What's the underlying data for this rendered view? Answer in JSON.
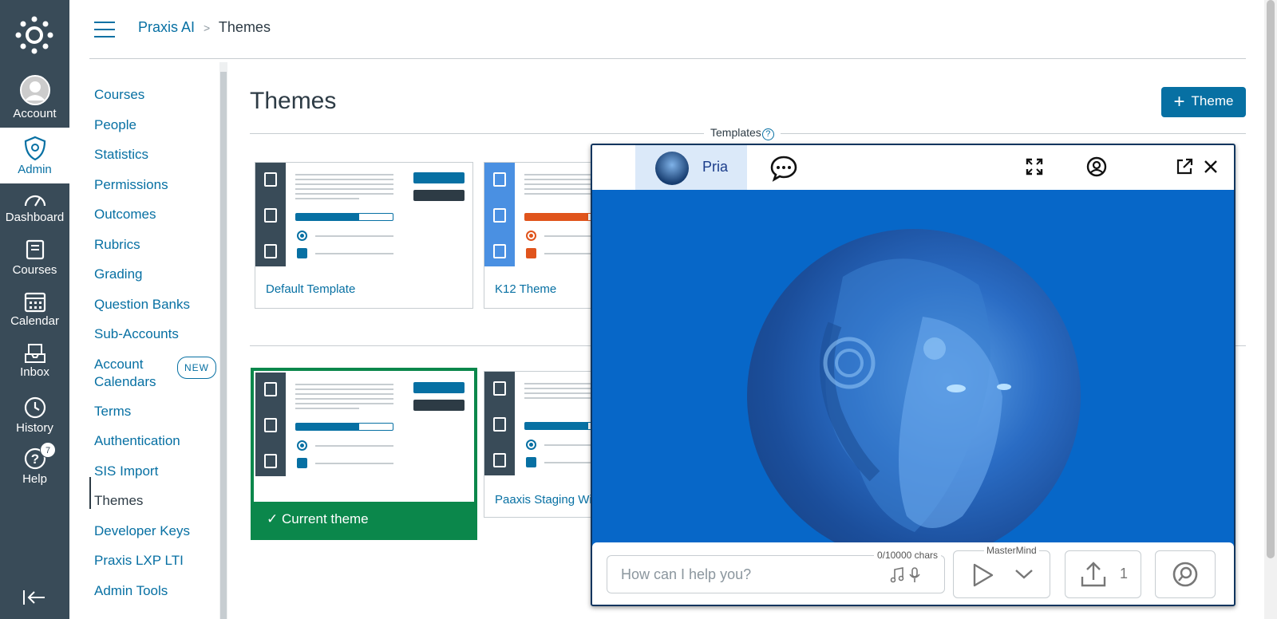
{
  "global_nav": {
    "items": [
      {
        "label": "Account",
        "icon": "account-avatar-icon"
      },
      {
        "label": "Admin",
        "icon": "admin-shield-icon",
        "active": true
      },
      {
        "label": "Dashboard",
        "icon": "dashboard-gauge-icon"
      },
      {
        "label": "Courses",
        "icon": "courses-book-icon"
      },
      {
        "label": "Calendar",
        "icon": "calendar-icon"
      },
      {
        "label": "Inbox",
        "icon": "inbox-icon"
      },
      {
        "label": "History",
        "icon": "history-clock-icon"
      },
      {
        "label": "Help",
        "icon": "help-question-icon",
        "badge": "7"
      }
    ]
  },
  "breadcrumb": {
    "root": "Praxis AI",
    "separator": ">",
    "current": "Themes"
  },
  "subnav": {
    "items": [
      "Courses",
      "People",
      "Statistics",
      "Permissions",
      "Outcomes",
      "Rubrics",
      "Grading",
      "Question Banks",
      "Sub-Accounts",
      "Account Calendars",
      "Terms",
      "Authentication",
      "SIS Import",
      "Themes",
      "Developer Keys",
      "Praxis LXP LTI",
      "Admin Tools"
    ],
    "account_calendars_line1": "Account",
    "account_calendars_line2": "Calendars",
    "new_badge": "NEW",
    "active": "Themes"
  },
  "main": {
    "title": "Themes",
    "add_button": "Theme",
    "templates_label": "Templates",
    "help_mark": "?",
    "templates": [
      {
        "name": "Default Template",
        "style": "default"
      },
      {
        "name": "K12 Theme",
        "style": "k12"
      }
    ],
    "themes": [
      {
        "name": "",
        "current": true,
        "current_label": "Current theme"
      },
      {
        "name": "Paaxis Staging With"
      }
    ]
  },
  "chat": {
    "tab_label": "Pria",
    "placeholder": "How can I help you?",
    "char_count": "0/10000 chars",
    "model_label": "MasterMind",
    "upload_count": "1",
    "colors": {
      "panel": "#0767c8",
      "tab": "#dbe9f9"
    }
  },
  "colors": {
    "nav": "#394b58",
    "link": "#0770a3",
    "success": "#0b874b",
    "accent_orange": "#e0541c"
  }
}
